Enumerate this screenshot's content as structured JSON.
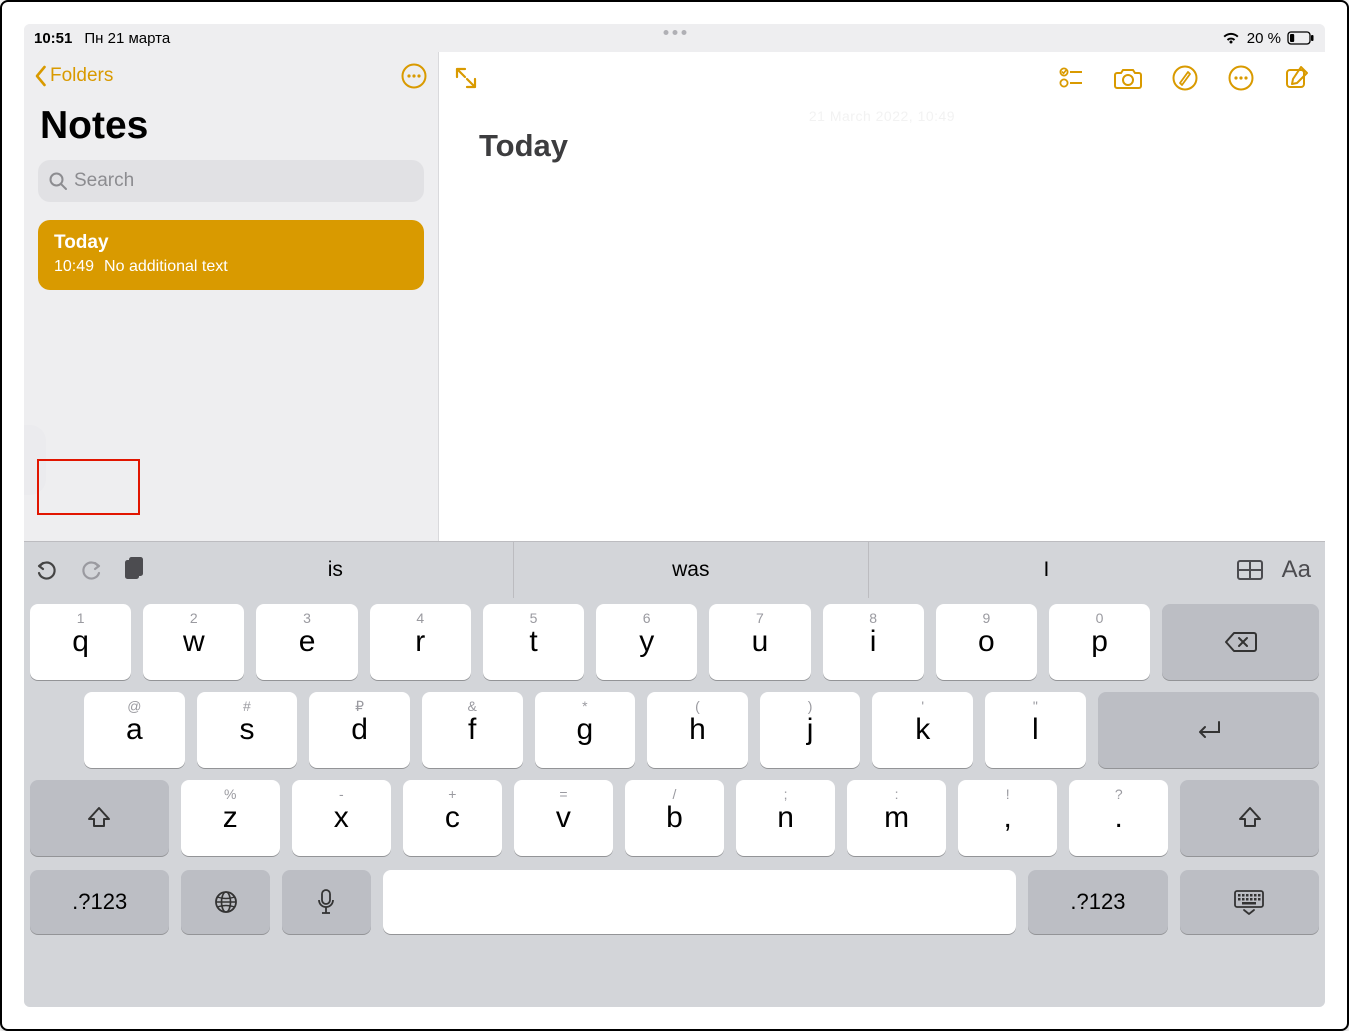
{
  "statusbar": {
    "time": "10:51",
    "date": "Пн 21 марта",
    "battery_pct": "20 %"
  },
  "sidebar": {
    "back_label": "Folders",
    "title": "Notes",
    "search_placeholder": "Search",
    "notes": [
      {
        "title": "Today",
        "time": "10:49",
        "preview": "No additional text"
      }
    ]
  },
  "editor": {
    "timestamp_faint": "21 March 2022, 10:49",
    "heading": "Today"
  },
  "keyboard": {
    "suggestions": [
      "is",
      "was",
      "I"
    ],
    "row1": [
      {
        "alt": "1",
        "main": "q"
      },
      {
        "alt": "2",
        "main": "w"
      },
      {
        "alt": "3",
        "main": "e"
      },
      {
        "alt": "4",
        "main": "r"
      },
      {
        "alt": "5",
        "main": "t"
      },
      {
        "alt": "6",
        "main": "y"
      },
      {
        "alt": "7",
        "main": "u"
      },
      {
        "alt": "8",
        "main": "i"
      },
      {
        "alt": "9",
        "main": "o"
      },
      {
        "alt": "0",
        "main": "p"
      }
    ],
    "row2": [
      {
        "alt": "@",
        "main": "a"
      },
      {
        "alt": "#",
        "main": "s"
      },
      {
        "alt": "₽",
        "main": "d"
      },
      {
        "alt": "&",
        "main": "f"
      },
      {
        "alt": "*",
        "main": "g"
      },
      {
        "alt": "(",
        "main": "h"
      },
      {
        "alt": ")",
        "main": "j"
      },
      {
        "alt": "'",
        "main": "k"
      },
      {
        "alt": "\"",
        "main": "l"
      }
    ],
    "row3": [
      {
        "alt": "%",
        "main": "z"
      },
      {
        "alt": "-",
        "main": "x"
      },
      {
        "alt": "+",
        "main": "c"
      },
      {
        "alt": "=",
        "main": "v"
      },
      {
        "alt": "/",
        "main": "b"
      },
      {
        "alt": ";",
        "main": "n"
      },
      {
        "alt": ":",
        "main": "m"
      },
      {
        "alt": "!",
        "main": ","
      },
      {
        "alt": "?",
        "main": "."
      }
    ],
    "row4": {
      "mode_label": ".?123"
    }
  }
}
